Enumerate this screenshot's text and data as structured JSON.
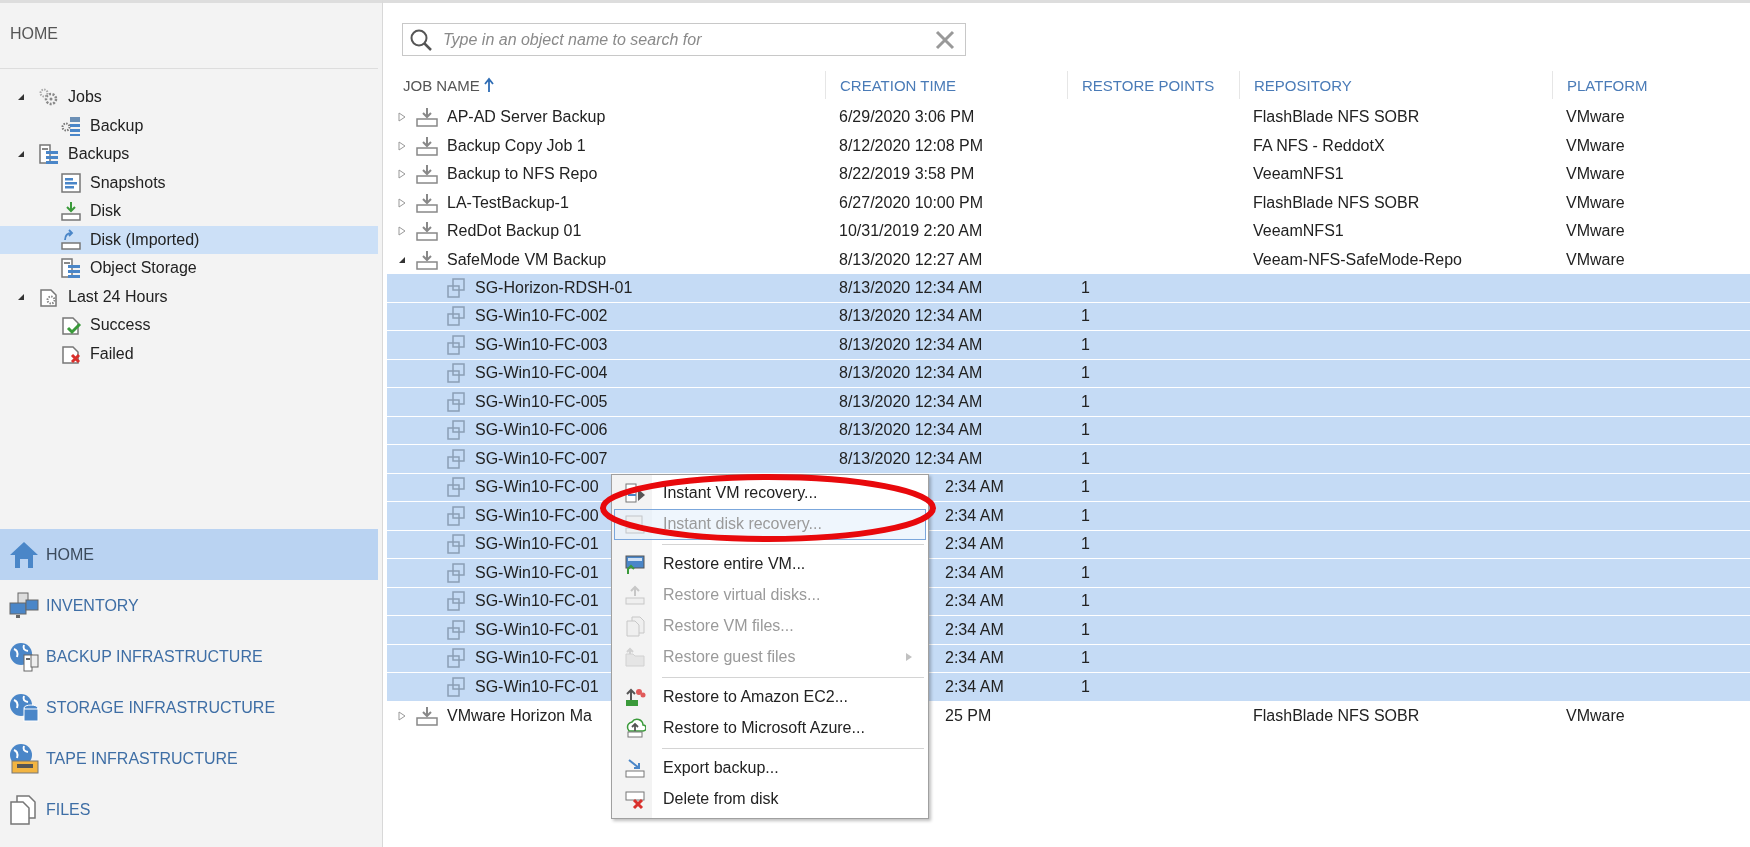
{
  "sidebar": {
    "title": "HOME",
    "tree": [
      {
        "label": "Jobs",
        "expanded": true,
        "selected": false,
        "children": [
          {
            "label": "Backup",
            "selected": false
          }
        ]
      },
      {
        "label": "Backups",
        "expanded": true,
        "selected": false,
        "children": [
          {
            "label": "Snapshots",
            "selected": false
          },
          {
            "label": "Disk",
            "selected": false
          },
          {
            "label": "Disk (Imported)",
            "selected": true
          },
          {
            "label": "Object Storage",
            "selected": false
          }
        ]
      },
      {
        "label": "Last 24 Hours",
        "expanded": true,
        "selected": false,
        "children": [
          {
            "label": "Success",
            "selected": false
          },
          {
            "label": "Failed",
            "selected": false
          }
        ]
      }
    ],
    "nav": [
      {
        "label": "HOME",
        "selected": true
      },
      {
        "label": "INVENTORY",
        "selected": false
      },
      {
        "label": "BACKUP INFRASTRUCTURE",
        "selected": false
      },
      {
        "label": "STORAGE INFRASTRUCTURE",
        "selected": false
      },
      {
        "label": "TAPE INFRASTRUCTURE",
        "selected": false
      },
      {
        "label": "FILES",
        "selected": false
      }
    ]
  },
  "search": {
    "placeholder": "Type in an object name to search for"
  },
  "table": {
    "columns": [
      {
        "label": "JOB NAME",
        "sorted": true
      },
      {
        "label": "CREATION TIME",
        "sorted": false
      },
      {
        "label": "RESTORE POINTS",
        "sorted": false
      },
      {
        "label": "REPOSITORY",
        "sorted": false
      },
      {
        "label": "PLATFORM",
        "sorted": false
      }
    ],
    "rows": [
      {
        "name": "AP-AD Server Backup",
        "creation_time": "6/29/2020 3:06 PM",
        "repository": "FlashBlade NFS SOBR",
        "platform": "VMware",
        "expanded": false,
        "selected": false
      },
      {
        "name": "Backup Copy Job 1",
        "creation_time": "8/12/2020 12:08 PM",
        "repository": "FA NFS - ReddotX",
        "platform": "VMware",
        "expanded": false,
        "selected": false
      },
      {
        "name": "Backup to NFS Repo",
        "creation_time": "8/22/2019 3:58 PM",
        "repository": "VeeamNFS1",
        "platform": "VMware",
        "expanded": false,
        "selected": false
      },
      {
        "name": "LA-TestBackup-1",
        "creation_time": "6/27/2020 10:00 PM",
        "repository": "FlashBlade NFS SOBR",
        "platform": "VMware",
        "expanded": false,
        "selected": false
      },
      {
        "name": "RedDot Backup 01",
        "creation_time": "10/31/2019 2:20 AM",
        "repository": "VeeamNFS1",
        "platform": "VMware",
        "expanded": false,
        "selected": false
      },
      {
        "name": "SafeMode VM Backup",
        "creation_time": "8/13/2020 12:27 AM",
        "repository": "Veeam-NFS-SafeMode-Repo",
        "platform": "VMware",
        "expanded": true,
        "selected": false,
        "children": [
          {
            "name": "SG-Horizon-RDSH-01",
            "creation_time": "8/13/2020 12:34 AM",
            "restore_points": "1",
            "selected": true
          },
          {
            "name": "SG-Win10-FC-002",
            "creation_time": "8/13/2020 12:34 AM",
            "restore_points": "1",
            "selected": true
          },
          {
            "name": "SG-Win10-FC-003",
            "creation_time": "8/13/2020 12:34 AM",
            "restore_points": "1",
            "selected": true
          },
          {
            "name": "SG-Win10-FC-004",
            "creation_time": "8/13/2020 12:34 AM",
            "restore_points": "1",
            "selected": true
          },
          {
            "name": "SG-Win10-FC-005",
            "creation_time": "8/13/2020 12:34 AM",
            "restore_points": "1",
            "selected": true
          },
          {
            "name": "SG-Win10-FC-006",
            "creation_time": "8/13/2020 12:34 AM",
            "restore_points": "1",
            "selected": true
          },
          {
            "name": "SG-Win10-FC-007",
            "creation_time": "8/13/2020 12:34 AM",
            "restore_points": "1",
            "selected": true
          },
          {
            "name": "SG-Win10-FC-00",
            "creation_time": "2:34 AM",
            "restore_points": "1",
            "selected": true
          },
          {
            "name": "SG-Win10-FC-00",
            "creation_time": "2:34 AM",
            "restore_points": "1",
            "selected": true
          },
          {
            "name": "SG-Win10-FC-01",
            "creation_time": "2:34 AM",
            "restore_points": "1",
            "selected": true
          },
          {
            "name": "SG-Win10-FC-01",
            "creation_time": "2:34 AM",
            "restore_points": "1",
            "selected": true
          },
          {
            "name": "SG-Win10-FC-01",
            "creation_time": "2:34 AM",
            "restore_points": "1",
            "selected": true
          },
          {
            "name": "SG-Win10-FC-01",
            "creation_time": "2:34 AM",
            "restore_points": "1",
            "selected": true
          },
          {
            "name": "SG-Win10-FC-01",
            "creation_time": "2:34 AM",
            "restore_points": "1",
            "selected": true
          },
          {
            "name": "SG-Win10-FC-01",
            "creation_time": "2:34 AM",
            "restore_points": "1",
            "selected": true
          }
        ]
      },
      {
        "name": "VMware Horizon Ma",
        "creation_time": "25 PM",
        "repository": "FlashBlade NFS SOBR",
        "platform": "VMware",
        "expanded": false,
        "selected": false
      }
    ]
  },
  "context_menu": {
    "items": [
      {
        "kind": "item",
        "label": "Instant VM recovery...",
        "disabled": false,
        "highlighted": false
      },
      {
        "kind": "item",
        "label": "Instant disk recovery...",
        "disabled": true,
        "highlighted": true
      },
      {
        "kind": "separator"
      },
      {
        "kind": "item",
        "label": "Restore entire VM...",
        "disabled": false,
        "highlighted": false
      },
      {
        "kind": "item",
        "label": "Restore virtual disks...",
        "disabled": true,
        "highlighted": false
      },
      {
        "kind": "item",
        "label": "Restore VM files...",
        "disabled": true,
        "highlighted": false
      },
      {
        "kind": "item",
        "label": "Restore guest files",
        "disabled": true,
        "highlighted": false,
        "submenu": true
      },
      {
        "kind": "separator"
      },
      {
        "kind": "item",
        "label": "Restore to Amazon EC2...",
        "disabled": false,
        "highlighted": false
      },
      {
        "kind": "item",
        "label": "Restore to Microsoft Azure...",
        "disabled": false,
        "highlighted": false
      },
      {
        "kind": "separator"
      },
      {
        "kind": "item",
        "label": "Export backup...",
        "disabled": false,
        "highlighted": false
      },
      {
        "kind": "item",
        "label": "Delete from disk",
        "disabled": false,
        "highlighted": false
      }
    ]
  }
}
